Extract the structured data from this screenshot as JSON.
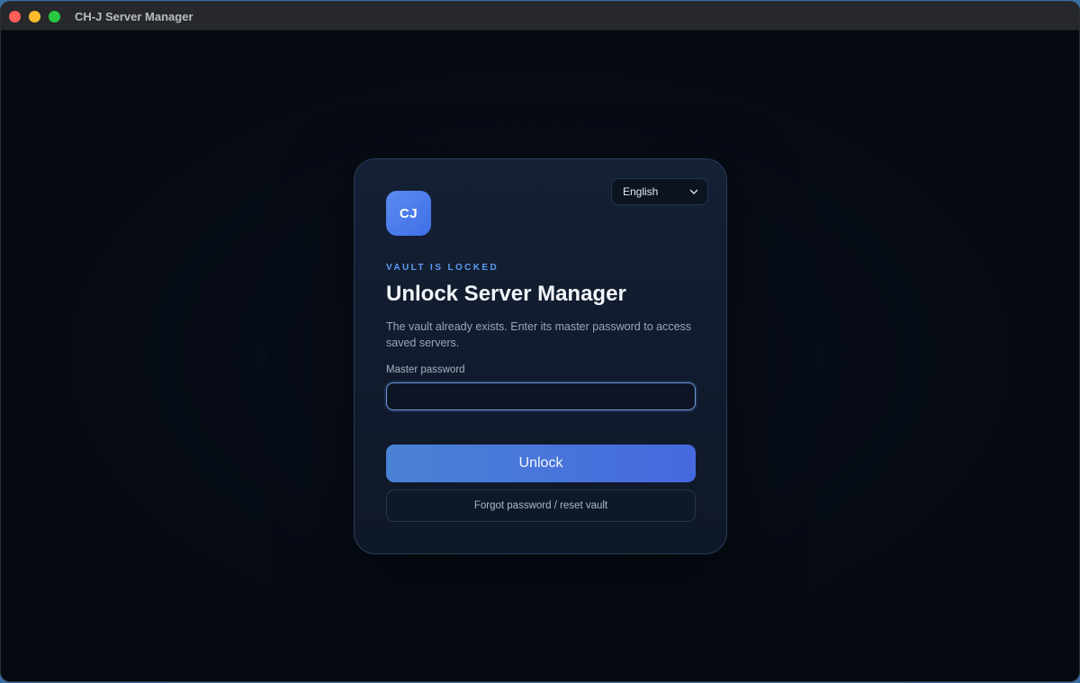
{
  "window": {
    "title": "CH-J Server Manager"
  },
  "card": {
    "logo_text": "CJ",
    "language": "English",
    "eyebrow": "VAULT IS LOCKED",
    "heading": "Unlock Server Manager",
    "description": "The vault already exists. Enter its master password to access saved servers.",
    "password_label": "Master password",
    "password_value": "",
    "unlock_label": "Unlock",
    "reset_label": "Forgot password / reset vault"
  },
  "colors": {
    "accent": "#4a7bdc",
    "eyebrow": "#5b9cf3",
    "background": "#050a13",
    "card": "#131e31"
  },
  "icons": {
    "language_chevron": "chevron-down-icon"
  }
}
